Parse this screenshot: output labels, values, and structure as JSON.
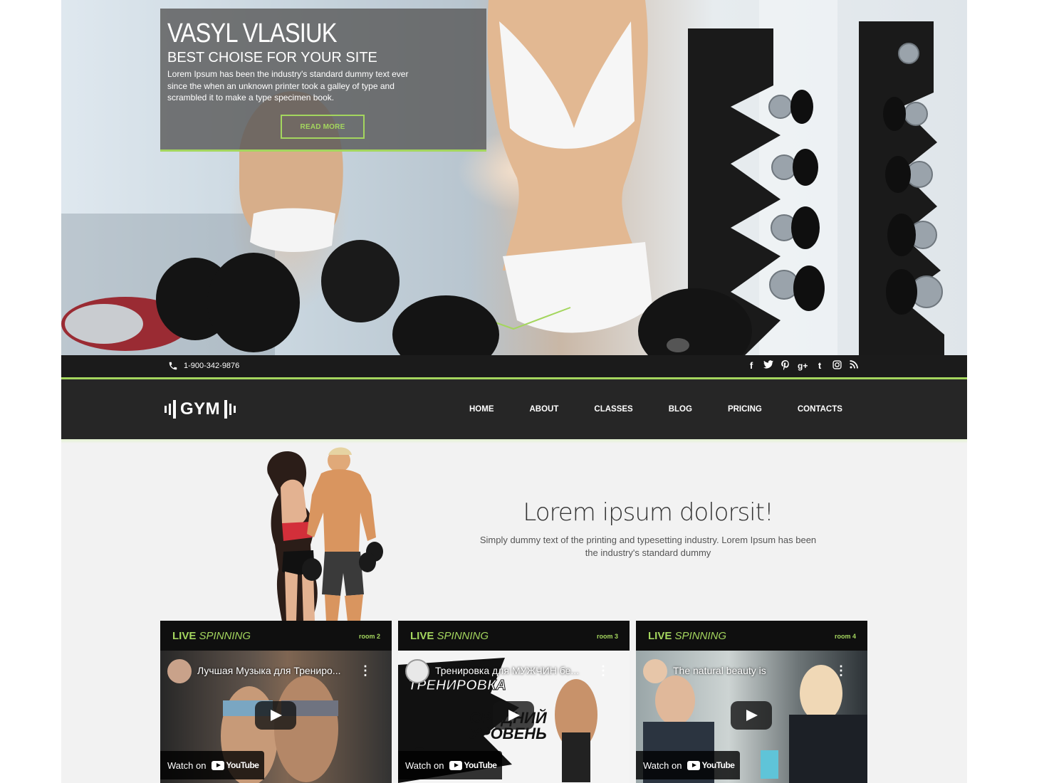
{
  "hero": {
    "title": "VASYL VLASIUK",
    "subtitle": "BEST CHOISE FOR YOUR SITE",
    "text": "Lorem Ipsum has been the industry's standard dummy text ever since the when an unknown printer took a galley of type and scrambled it to make a type specimen book.",
    "button": "READ MORE"
  },
  "topbar": {
    "phone": "1-900-342-9876",
    "socials": [
      "facebook-icon",
      "twitter-icon",
      "pinterest-icon",
      "google-plus-icon",
      "tumblr-icon",
      "instagram-icon",
      "rss-icon"
    ]
  },
  "nav": {
    "logo": "GYM",
    "items": [
      "HOME",
      "ABOUT",
      "CLASSES",
      "BLOG",
      "PRICING",
      "CONTACTS"
    ]
  },
  "about": {
    "title": "Lorem ipsum dolorsit!",
    "text": "Simply dummy text of the printing and typesetting industry. Lorem Ipsum has been the industry's standard dummy"
  },
  "cards": [
    {
      "title_a": "LIVE",
      "title_b": "SPINNING",
      "room": "room 2",
      "video_title": "Лучшая Музыка для Трениро...",
      "watch": "Watch on",
      "yt": "YouTube"
    },
    {
      "title_a": "LIVE",
      "title_b": "SPINNING",
      "room": "room 3",
      "video_title": "Тренировка для МУЖЧИН бе...",
      "overlay_a": "ТРЕНИРОВКА",
      "overlay_b": "СРЕДНИЙ",
      "overlay_c": "УРОВЕНЬ",
      "watch": "Watch on",
      "yt": "YouTube"
    },
    {
      "title_a": "LIVE",
      "title_b": "SPINNING",
      "room": "room 4",
      "video_title": "The natural beauty is",
      "watch": "Watch on",
      "yt": "YouTube"
    }
  ],
  "colors": {
    "accent": "#a4d65e",
    "dark": "#1b1b1b",
    "nav": "#262626"
  }
}
